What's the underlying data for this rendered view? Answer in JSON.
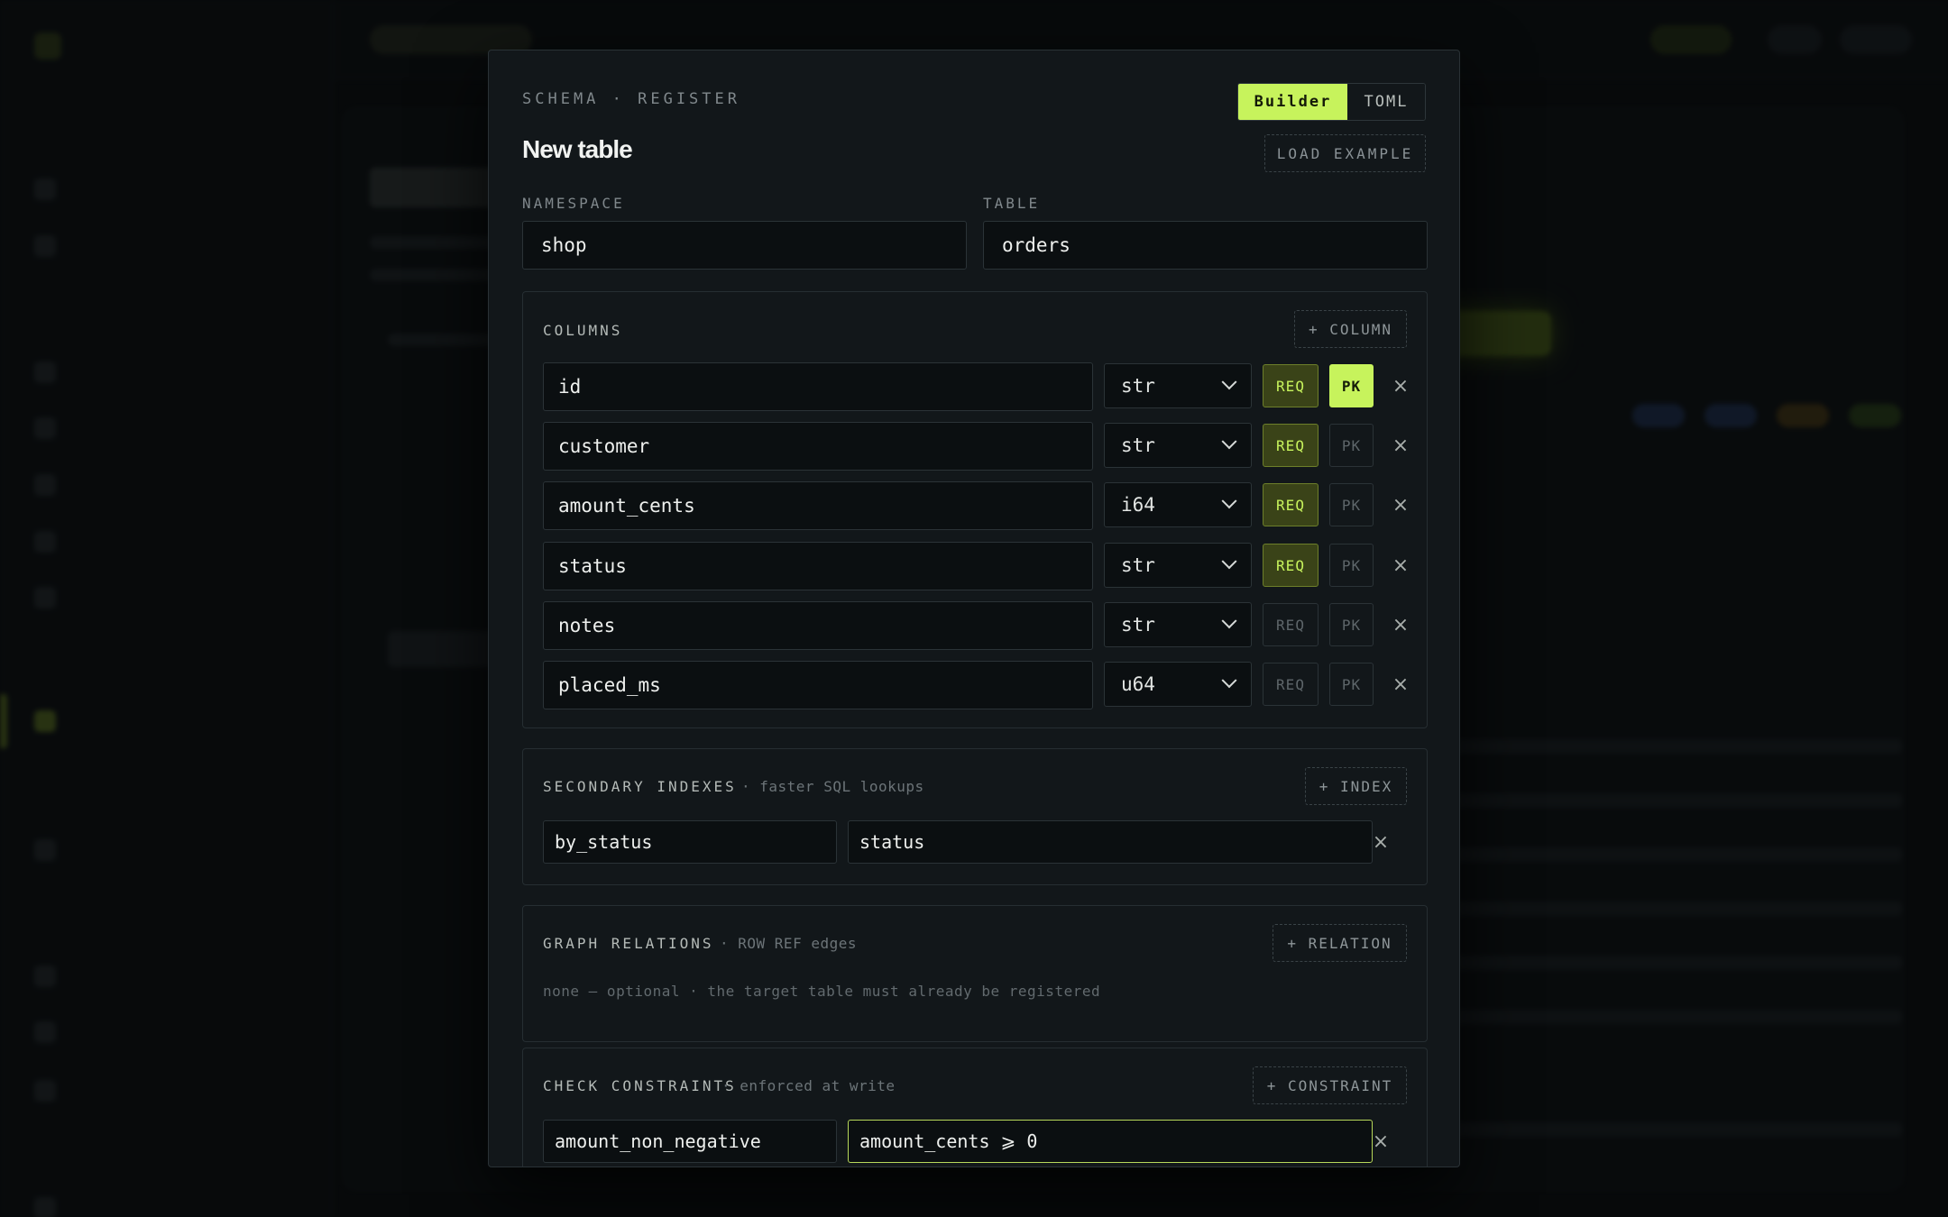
{
  "modal": {
    "eyebrow": "SCHEMA · REGISTER",
    "title": "New table",
    "mode_builder": "Builder",
    "mode_toml": "TOML",
    "load_example": "LOAD EXAMPLE",
    "namespace_label": "NAMESPACE",
    "namespace_value": "shop",
    "table_label": "TABLE",
    "table_value": "orders"
  },
  "columns": {
    "title": "COLUMNS",
    "add": "+ COLUMN",
    "req_label": "REQ",
    "pk_label": "PK",
    "remove_glyph": "×",
    "rows": [
      {
        "name": "id",
        "type": "str",
        "required": true,
        "primary_key": true
      },
      {
        "name": "customer",
        "type": "str",
        "required": true,
        "primary_key": false
      },
      {
        "name": "amount_cents",
        "type": "i64",
        "required": true,
        "primary_key": false
      },
      {
        "name": "status",
        "type": "str",
        "required": true,
        "primary_key": false
      },
      {
        "name": "notes",
        "type": "str",
        "required": false,
        "primary_key": false
      },
      {
        "name": "placed_ms",
        "type": "u64",
        "required": false,
        "primary_key": false
      }
    ]
  },
  "indexes": {
    "title": "SECONDARY INDEXES",
    "subtitle": "· faster SQL lookups",
    "add": "+ INDEX",
    "rows": [
      {
        "name": "by_status",
        "column": "status"
      }
    ]
  },
  "relations": {
    "title": "GRAPH RELATIONS",
    "subtitle": "· ROW REF edges",
    "add": "+ RELATION",
    "empty_hint": "none — optional · the target table must already be registered"
  },
  "constraints": {
    "title": "CHECK CONSTRAINTS",
    "subtitle": "· enforced at write",
    "add": "+ CONSTRAINT",
    "rows": [
      {
        "name": "amount_non_negative",
        "expression": "amount_cents ⩾ 0"
      }
    ]
  },
  "colors": {
    "accent": "#c7f35c",
    "modal_bg": "#12171a",
    "page_bg": "#07090a"
  }
}
